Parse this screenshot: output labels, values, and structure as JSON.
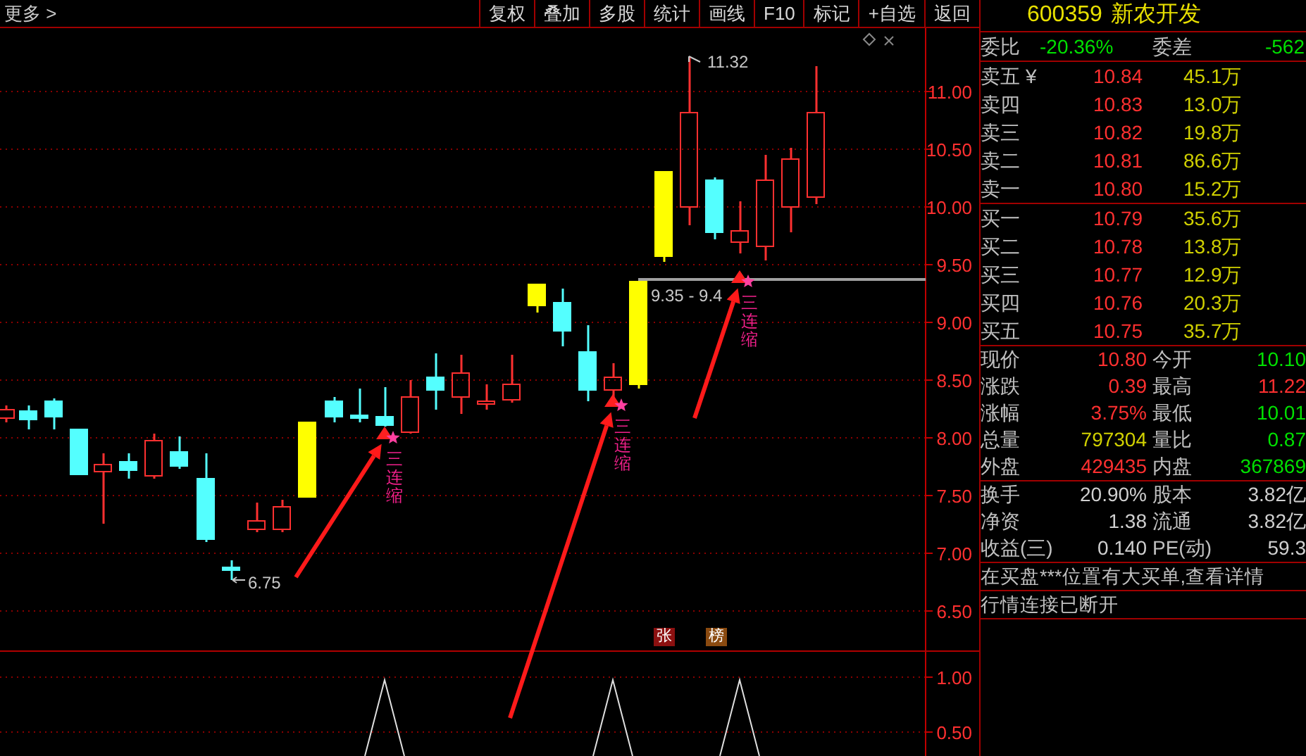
{
  "toolbar": {
    "more": "更多 >",
    "buttons": [
      "复权",
      "叠加",
      "多股",
      "统计",
      "画线",
      "F10",
      "标记",
      "+自选",
      "返回"
    ]
  },
  "chart": {
    "price_axis": [
      "11.00",
      "10.50",
      "10.00",
      "9.50",
      "9.00",
      "8.50",
      "8.00",
      "7.50",
      "7.00",
      "6.50"
    ],
    "indicator_axis": [
      "1.00",
      "0.50"
    ],
    "high_label": "11.32",
    "low_label": "6.75",
    "range_label": "9.35 - 9.4",
    "signals": [
      "三连缩",
      "三连缩",
      "三连缩"
    ],
    "badges": [
      {
        "text": "张",
        "color": "#8c1010"
      },
      {
        "text": "榜",
        "color": "#8a4a10"
      }
    ]
  },
  "quote": {
    "code": "600359",
    "name": "新农开发",
    "ratio": {
      "label": "委比",
      "value": "-20.36%",
      "label2": "委差",
      "value2": "-562"
    },
    "asks": [
      {
        "label": "卖五",
        "currency": "¥",
        "price": "10.84",
        "volume": "45.1万"
      },
      {
        "label": "卖四",
        "price": "10.83",
        "volume": "13.0万"
      },
      {
        "label": "卖三",
        "price": "10.82",
        "volume": "19.8万"
      },
      {
        "label": "卖二",
        "price": "10.81",
        "volume": "86.6万"
      },
      {
        "label": "卖一",
        "price": "10.80",
        "volume": "15.2万"
      }
    ],
    "bids": [
      {
        "label": "买一",
        "price": "10.79",
        "volume": "35.6万"
      },
      {
        "label": "买二",
        "price": "10.78",
        "volume": "13.8万"
      },
      {
        "label": "买三",
        "price": "10.77",
        "volume": "12.9万"
      },
      {
        "label": "买四",
        "price": "10.76",
        "volume": "20.3万"
      },
      {
        "label": "买五",
        "price": "10.75",
        "volume": "35.7万"
      }
    ],
    "stats": [
      {
        "label": "现价",
        "value": "10.80",
        "color": "#ff3030"
      },
      {
        "label": "今开",
        "value": "10.10",
        "color": "#00e000"
      },
      {
        "label": "涨跌",
        "value": "0.39",
        "color": "#ff3030"
      },
      {
        "label": "最高",
        "value": "11.22",
        "color": "#ff3030"
      },
      {
        "label": "涨幅",
        "value": "3.75%",
        "color": "#ff3030"
      },
      {
        "label": "最低",
        "value": "10.01",
        "color": "#00e000"
      },
      {
        "label": "总量",
        "value": "797304",
        "color": "#d0d000"
      },
      {
        "label": "量比",
        "value": "0.87",
        "color": "#00e000"
      },
      {
        "label": "外盘",
        "value": "429435",
        "color": "#ff3030"
      },
      {
        "label": "内盘",
        "value": "367869",
        "color": "#00e000"
      }
    ],
    "info": [
      {
        "label": "换手",
        "value": "20.90%"
      },
      {
        "label": "股本",
        "value": "3.82亿"
      },
      {
        "label": "净资",
        "value": "1.38"
      },
      {
        "label": "流通",
        "value": "3.82亿"
      },
      {
        "label": "收益(三)",
        "value": "0.140"
      },
      {
        "label": "PE(动)",
        "value": "59.3"
      }
    ],
    "messages": [
      "在买盘***位置有大买单,查看详情",
      "行情连接已断开"
    ]
  }
}
